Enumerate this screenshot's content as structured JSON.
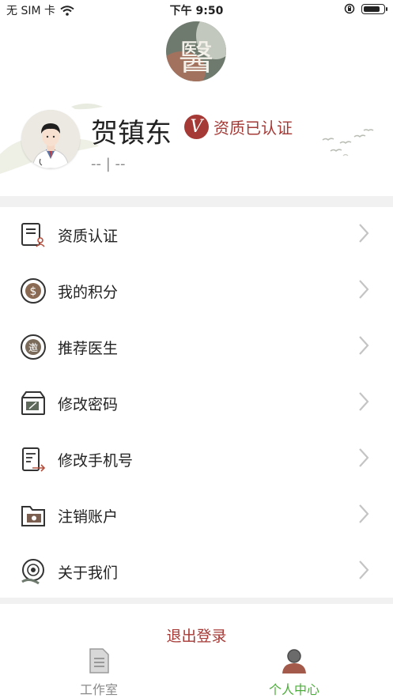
{
  "status_bar": {
    "carrier": "无 SIM 卡",
    "time": "下午 9:50"
  },
  "profile": {
    "name": "贺镇东",
    "badge_text": "资质已认证",
    "badge_letter": "V",
    "subtitle": "-- | --"
  },
  "menu": {
    "items": [
      {
        "label": "资质认证",
        "icon": "certificate-icon"
      },
      {
        "label": "我的积分",
        "icon": "points-coin-icon"
      },
      {
        "label": "推荐医生",
        "icon": "invite-icon"
      },
      {
        "label": "修改密码",
        "icon": "password-box-icon"
      },
      {
        "label": "修改手机号",
        "icon": "phone-change-icon"
      },
      {
        "label": "注销账户",
        "icon": "account-folder-icon"
      },
      {
        "label": "关于我们",
        "icon": "about-eye-icon"
      }
    ]
  },
  "logout_label": "退出登录",
  "tabs": [
    {
      "label": "工作室",
      "icon": "document-icon",
      "active": false
    },
    {
      "label": "个人中心",
      "icon": "person-icon",
      "active": true
    }
  ],
  "colors": {
    "accent_red": "#a53935",
    "active_green": "#4cae3a",
    "separator": "#f1f1f1"
  }
}
